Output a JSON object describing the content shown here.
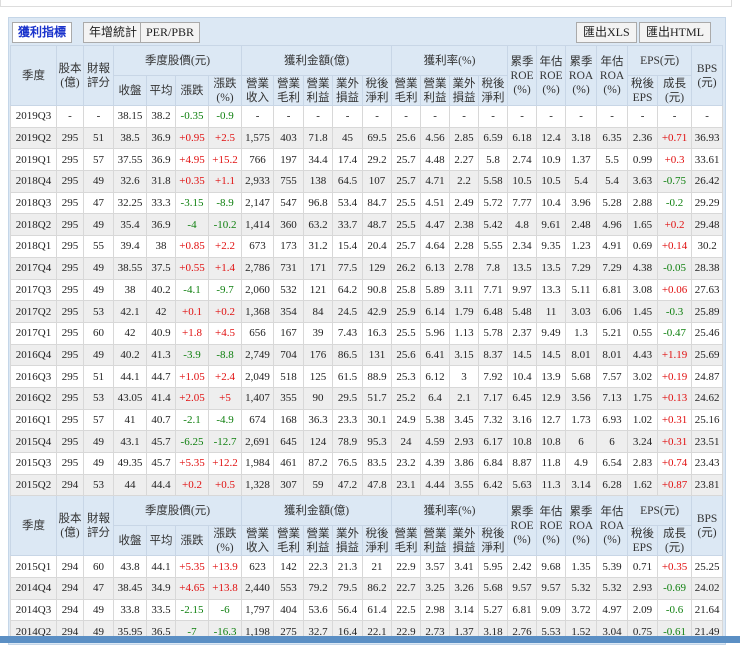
{
  "toolbar": {
    "tabs": [
      "獲利指標",
      "年增統計",
      "PER/PBR"
    ],
    "export_xls": "匯出XLS",
    "export_html": "匯出HTML"
  },
  "header": {
    "row1": [
      {
        "label": "季度",
        "rs": 2,
        "cs": 1
      },
      {
        "label": "股本\n(億)",
        "rs": 2,
        "cs": 1
      },
      {
        "label": "財報\n評分",
        "rs": 2,
        "cs": 1
      },
      {
        "label": "季度股價(元)",
        "rs": 1,
        "cs": 4
      },
      {
        "label": "獲利金額(億)",
        "rs": 1,
        "cs": 5
      },
      {
        "label": "獲利率(%)",
        "rs": 1,
        "cs": 4
      },
      {
        "label": "累季\nROE\n(%)",
        "rs": 2,
        "cs": 1
      },
      {
        "label": "年估\nROE\n(%)",
        "rs": 2,
        "cs": 1
      },
      {
        "label": "累季\nROA\n(%)",
        "rs": 2,
        "cs": 1
      },
      {
        "label": "年估\nROA\n(%)",
        "rs": 2,
        "cs": 1
      },
      {
        "label": "EPS(元)",
        "rs": 1,
        "cs": 2
      },
      {
        "label": "BPS\n(元)",
        "rs": 2,
        "cs": 1
      }
    ],
    "row2": [
      "收盤",
      "平均",
      "漲跌",
      "漲跌\n(%)",
      "營業\n收入",
      "營業\n毛利",
      "營業\n利益",
      "業外\n損益",
      "稅後\n淨利",
      "營業\n毛利",
      "營業\n利益",
      "業外\n損益",
      "稅後\n淨利",
      "稅後\nEPS",
      "成長\n(元)"
    ]
  },
  "colors": {
    "up": "#e01010",
    "down": "#108010",
    "header_bg": "#dce8f4"
  },
  "rows": [
    [
      "2019Q3",
      "-",
      "-",
      "38.15",
      "38.2",
      "-0.35",
      "-0.9",
      "-",
      "-",
      "-",
      "-",
      "-",
      "-",
      "-",
      "-",
      "-",
      "-",
      "-",
      "-",
      "-",
      "-",
      "-",
      "-"
    ],
    [
      "2019Q2",
      "295",
      "51",
      "38.5",
      "36.9",
      "+0.95",
      "+2.5",
      "1,575",
      "403",
      "71.8",
      "45",
      "69.5",
      "25.6",
      "4.56",
      "2.85",
      "6.59",
      "6.18",
      "12.4",
      "3.18",
      "6.35",
      "2.36",
      "+0.71",
      "36.93"
    ],
    [
      "2019Q1",
      "295",
      "57",
      "37.55",
      "36.9",
      "+4.95",
      "+15.2",
      "766",
      "197",
      "34.4",
      "17.4",
      "29.2",
      "25.7",
      "4.48",
      "2.27",
      "5.8",
      "2.74",
      "10.9",
      "1.37",
      "5.5",
      "0.99",
      "+0.3",
      "33.61"
    ],
    [
      "2018Q4",
      "295",
      "49",
      "32.6",
      "31.8",
      "+0.35",
      "+1.1",
      "2,933",
      "755",
      "138",
      "64.5",
      "107",
      "25.7",
      "4.71",
      "2.2",
      "5.58",
      "10.5",
      "10.5",
      "5.4",
      "5.4",
      "3.63",
      "-0.75",
      "26.42"
    ],
    [
      "2018Q3",
      "295",
      "47",
      "32.25",
      "33.3",
      "-3.15",
      "-8.9",
      "2,147",
      "547",
      "96.8",
      "53.4",
      "84.7",
      "25.5",
      "4.51",
      "2.49",
      "5.72",
      "7.77",
      "10.4",
      "3.96",
      "5.28",
      "2.88",
      "-0.2",
      "29.29"
    ],
    [
      "2018Q2",
      "295",
      "49",
      "35.4",
      "36.9",
      "-4",
      "-10.2",
      "1,414",
      "360",
      "63.2",
      "33.7",
      "48.7",
      "25.5",
      "4.47",
      "2.38",
      "5.42",
      "4.8",
      "9.61",
      "2.48",
      "4.96",
      "1.65",
      "+0.2",
      "29.48"
    ],
    [
      "2018Q1",
      "295",
      "55",
      "39.4",
      "38",
      "+0.85",
      "+2.2",
      "673",
      "173",
      "31.2",
      "15.4",
      "20.4",
      "25.7",
      "4.64",
      "2.28",
      "5.55",
      "2.34",
      "9.35",
      "1.23",
      "4.91",
      "0.69",
      "+0.14",
      "30.2"
    ],
    [
      "2017Q4",
      "295",
      "49",
      "38.55",
      "37.5",
      "+0.55",
      "+1.4",
      "2,786",
      "731",
      "171",
      "77.5",
      "129",
      "26.2",
      "6.13",
      "2.78",
      "7.8",
      "13.5",
      "13.5",
      "7.29",
      "7.29",
      "4.38",
      "-0.05",
      "28.38"
    ],
    [
      "2017Q3",
      "295",
      "49",
      "38",
      "40.2",
      "-4.1",
      "-9.7",
      "2,060",
      "532",
      "121",
      "64.2",
      "90.8",
      "25.8",
      "5.89",
      "3.11",
      "7.71",
      "9.97",
      "13.3",
      "5.11",
      "6.81",
      "3.08",
      "+0.06",
      "27.63"
    ],
    [
      "2017Q2",
      "295",
      "53",
      "42.1",
      "42",
      "+0.1",
      "+0.2",
      "1,368",
      "354",
      "84",
      "24.5",
      "42.9",
      "25.9",
      "6.14",
      "1.79",
      "6.48",
      "5.48",
      "11",
      "3.03",
      "6.06",
      "1.45",
      "-0.3",
      "25.89"
    ],
    [
      "2017Q1",
      "295",
      "60",
      "42",
      "40.9",
      "+1.8",
      "+4.5",
      "656",
      "167",
      "39",
      "7.43",
      "16.3",
      "25.5",
      "5.96",
      "1.13",
      "5.78",
      "2.37",
      "9.49",
      "1.3",
      "5.21",
      "0.55",
      "-0.47",
      "25.46"
    ],
    [
      "2016Q4",
      "295",
      "49",
      "40.2",
      "41.3",
      "-3.9",
      "-8.8",
      "2,749",
      "704",
      "176",
      "86.5",
      "131",
      "25.6",
      "6.41",
      "3.15",
      "8.37",
      "14.5",
      "14.5",
      "8.01",
      "8.01",
      "4.43",
      "+1.19",
      "25.69"
    ],
    [
      "2016Q3",
      "295",
      "51",
      "44.1",
      "44.7",
      "+1.05",
      "+2.4",
      "2,049",
      "518",
      "125",
      "61.5",
      "88.9",
      "25.3",
      "6.12",
      "3",
      "7.92",
      "10.4",
      "13.9",
      "5.68",
      "7.57",
      "3.02",
      "+0.19",
      "24.87"
    ],
    [
      "2016Q2",
      "295",
      "53",
      "43.05",
      "41.4",
      "+2.05",
      "+5",
      "1,407",
      "355",
      "90",
      "29.5",
      "51.7",
      "25.2",
      "6.4",
      "2.1",
      "7.17",
      "6.45",
      "12.9",
      "3.56",
      "7.13",
      "1.75",
      "+0.13",
      "24.62"
    ],
    [
      "2016Q1",
      "295",
      "57",
      "41",
      "40.7",
      "-2.1",
      "-4.9",
      "674",
      "168",
      "36.3",
      "23.3",
      "30.1",
      "24.9",
      "5.38",
      "3.45",
      "7.32",
      "3.16",
      "12.7",
      "1.73",
      "6.93",
      "1.02",
      "+0.31",
      "25.16"
    ],
    [
      "2015Q4",
      "295",
      "49",
      "43.1",
      "45.7",
      "-6.25",
      "-12.7",
      "2,691",
      "645",
      "124",
      "78.9",
      "95.3",
      "24",
      "4.59",
      "2.93",
      "6.17",
      "10.8",
      "10.8",
      "6",
      "6",
      "3.24",
      "+0.31",
      "23.51"
    ],
    [
      "2015Q3",
      "295",
      "49",
      "49.35",
      "45.7",
      "+5.35",
      "+12.2",
      "1,984",
      "461",
      "87.2",
      "76.5",
      "83.5",
      "23.2",
      "4.39",
      "3.86",
      "6.84",
      "8.87",
      "11.8",
      "4.9",
      "6.54",
      "2.83",
      "+0.74",
      "23.43"
    ],
    [
      "2015Q2",
      "294",
      "53",
      "44",
      "44.4",
      "+0.2",
      "+0.5",
      "1,328",
      "307",
      "59",
      "47.2",
      "47.8",
      "23.1",
      "4.44",
      "3.55",
      "6.42",
      "5.63",
      "11.3",
      "3.14",
      "6.28",
      "1.62",
      "+0.87",
      "23.81"
    ],
    [
      "2015Q1",
      "294",
      "60",
      "43.8",
      "44.1",
      "+5.35",
      "+13.9",
      "623",
      "142",
      "22.3",
      "21.3",
      "21",
      "22.9",
      "3.57",
      "3.41",
      "5.95",
      "2.42",
      "9.68",
      "1.35",
      "5.39",
      "0.71",
      "+0.35",
      "25.25"
    ],
    [
      "2014Q4",
      "294",
      "47",
      "38.45",
      "34.9",
      "+4.65",
      "+13.8",
      "2,440",
      "553",
      "79.2",
      "79.5",
      "86.2",
      "22.7",
      "3.25",
      "3.26",
      "5.68",
      "9.57",
      "9.57",
      "5.32",
      "5.32",
      "2.93",
      "-0.69",
      "24.02"
    ],
    [
      "2014Q3",
      "294",
      "49",
      "33.8",
      "33.5",
      "-2.15",
      "-6",
      "1,797",
      "404",
      "53.6",
      "56.4",
      "61.4",
      "22.5",
      "2.98",
      "3.14",
      "5.27",
      "6.81",
      "9.09",
      "3.72",
      "4.97",
      "2.09",
      "-0.6",
      "21.64"
    ],
    [
      "2014Q2",
      "294",
      "49",
      "35.95",
      "36.5",
      "-7",
      "-16.3",
      "1,198",
      "275",
      "32.7",
      "16.4",
      "22.1",
      "22.9",
      "2.73",
      "1.37",
      "3.18",
      "2.76",
      "5.53",
      "1.52",
      "3.04",
      "0.75",
      "-0.61",
      "21.49"
    ]
  ]
}
